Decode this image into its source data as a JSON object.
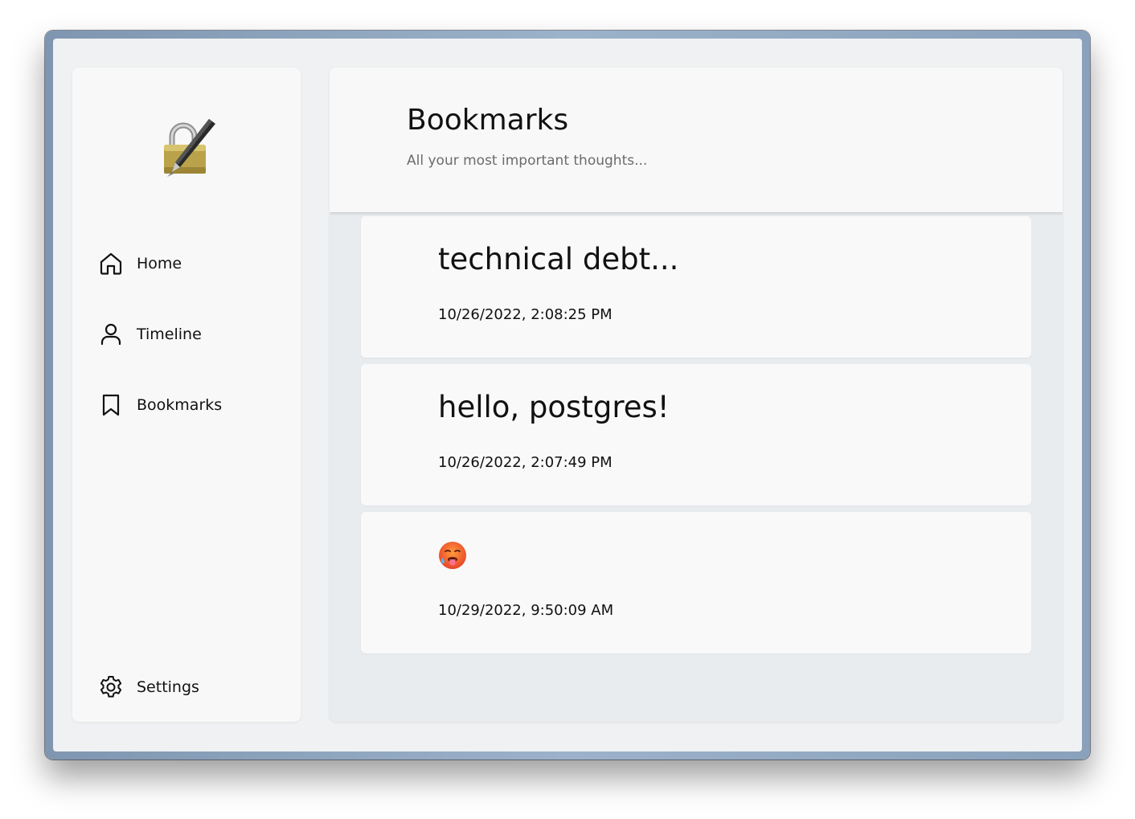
{
  "sidebar": {
    "logo_icon": "locked-with-pen-icon",
    "nav": [
      {
        "label": "Home",
        "icon": "home-icon"
      },
      {
        "label": "Timeline",
        "icon": "user-icon"
      },
      {
        "label": "Bookmarks",
        "icon": "bookmark-icon"
      }
    ],
    "settings": {
      "label": "Settings",
      "icon": "gear-icon"
    }
  },
  "header": {
    "title": "Bookmarks",
    "subtitle": "All your most important thoughts..."
  },
  "bookmarks": [
    {
      "text": "technical debt...",
      "date": "10/26/2022, 2:08:25 PM"
    },
    {
      "text": "hello, postgres!",
      "date": "10/26/2022, 2:07:49 PM"
    },
    {
      "icon": "hot-face-emoji-icon",
      "date": "10/29/2022, 9:50:09 AM"
    }
  ],
  "colors": {
    "window_frame": "#8aa1bb",
    "app_background": "#eff1f3",
    "panel_background": "#f8f8f8",
    "content_background": "#e9ecef",
    "text": "#111111",
    "muted_text": "#6b6b6b"
  }
}
